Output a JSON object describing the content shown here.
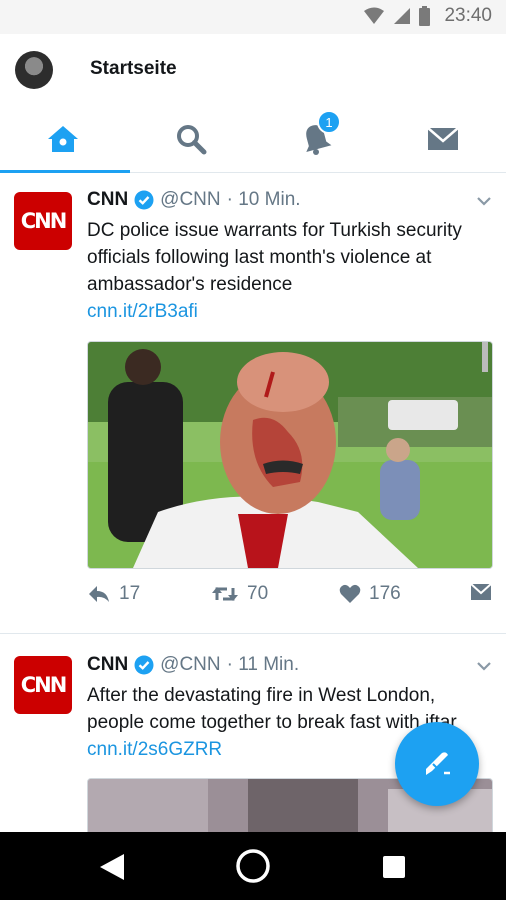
{
  "status_bar": {
    "time": "23:40",
    "icons": [
      "wifi-icon",
      "signal-icon",
      "battery-icon"
    ]
  },
  "header": {
    "title": "Startseite"
  },
  "tabs": [
    {
      "name": "home",
      "icon": "home-icon",
      "active": true
    },
    {
      "name": "search",
      "icon": "search-icon",
      "active": false
    },
    {
      "name": "notifications",
      "icon": "bell-icon",
      "badge": "1",
      "active": false
    },
    {
      "name": "messages",
      "icon": "envelope-icon",
      "active": false
    }
  ],
  "tweets": [
    {
      "avatar_text": "CNN",
      "name": "CNN",
      "handle": "@CNN",
      "time": "· 10 Min.",
      "text": "DC police issue warrants for Turkish security officials following last month's violence at ambassador's residence",
      "link": "cnn.it/2rB3afi",
      "image_alt": "Injured man with bloodied face outdoors",
      "replies": "17",
      "retweets": "70",
      "likes": "176"
    },
    {
      "avatar_text": "CNN",
      "name": "CNN",
      "handle": "@CNN",
      "time": "· 11 Min.",
      "text": "After the devastating fire in West London, people come together to break fast with iftar",
      "link": "cnn.it/2s6GZRR",
      "image_alt": "Photo preview"
    }
  ],
  "colors": {
    "accent": "#1da1f2",
    "link": "#1b95e0",
    "cnn_red": "#cc0000",
    "muted": "#657786"
  }
}
